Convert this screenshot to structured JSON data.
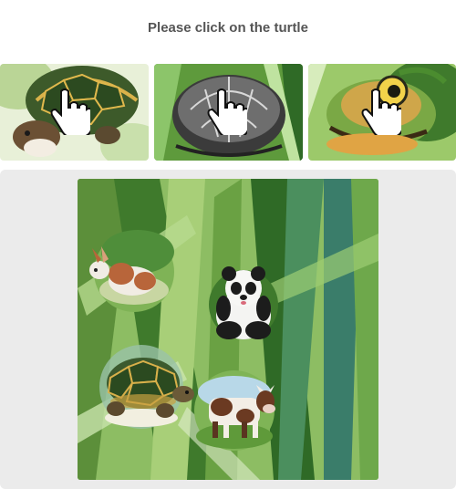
{
  "prompt": {
    "text": "Please click on the turtle"
  },
  "examples": [
    {
      "subject": "turtle",
      "icon": "hand-pointer-icon"
    },
    {
      "subject": "turtle",
      "icon": "hand-pointer-icon"
    },
    {
      "subject": "turtle",
      "icon": "hand-pointer-icon"
    }
  ],
  "board": {
    "background": "leaves",
    "animals": [
      "rabbit",
      "panda",
      "turtle",
      "cow"
    ]
  },
  "colors": {
    "prompt_text": "#555555",
    "panel_background": "#ebebeb",
    "leaf_dark": "#3f7a2c",
    "leaf_light": "#a8cf78"
  }
}
